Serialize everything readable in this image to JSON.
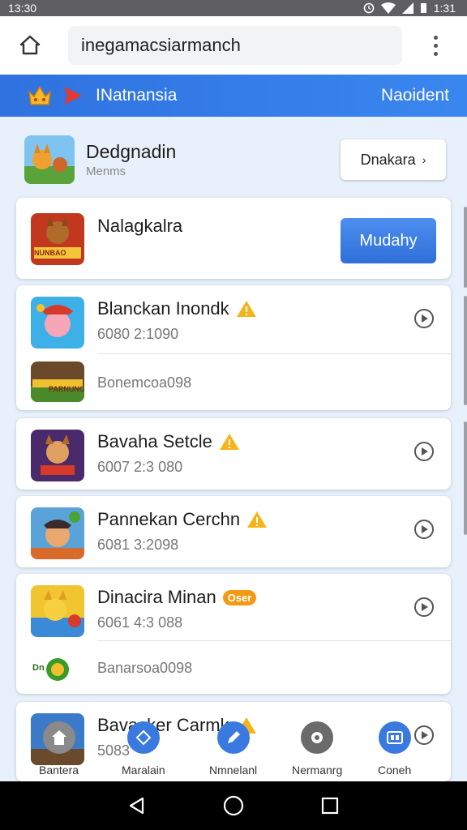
{
  "status_bar": {
    "time": "13:30",
    "clock_right": "1:31"
  },
  "browser": {
    "url": "inegamacsiarmanch",
    "home_icon": "home-icon",
    "menu_icon": "more-vert-icon"
  },
  "header": {
    "title": "INatnansia",
    "action_label": "Naoident",
    "accent": "#2f72e0"
  },
  "featured": {
    "title": "Dedgnadin",
    "subtitle": "Menms",
    "button_label": "Dnakara"
  },
  "promo": {
    "title": "Nalagkalra",
    "button_label": "Mudahy",
    "thumb_text": "NUNBAO"
  },
  "games": [
    {
      "title": "Blanckan Inondk",
      "meta": "6080 2:1090",
      "indicator": "warning",
      "sub_meta": "Bonemcoa098",
      "sub_thumb_text": "PARNUNG"
    },
    {
      "title": "Bavaha Setcle",
      "meta": "6007 2:3 080",
      "indicator": "warning"
    },
    {
      "title": "Pannekan Cerchn",
      "meta": "6081 3:2098",
      "indicator": "warning"
    },
    {
      "title": "Dinacira Minan",
      "meta": "6061 4:3 088",
      "indicator": "badge",
      "badge_text": "Oser",
      "sub_meta": "Banarsoa0098",
      "sub_thumb_text": "Dn"
    },
    {
      "title": "Bavacker Carmk",
      "meta": "5083",
      "indicator": "warning"
    }
  ],
  "bottom_nav": [
    {
      "label": "Bantera",
      "icon": "home-icon"
    },
    {
      "label": "Maralain",
      "icon": "grid-icon"
    },
    {
      "label": "Nmnelanl",
      "icon": "pencil-icon"
    },
    {
      "label": "Nermanrg",
      "icon": "gear-icon"
    },
    {
      "label": "Coneh",
      "icon": "games-icon"
    }
  ]
}
